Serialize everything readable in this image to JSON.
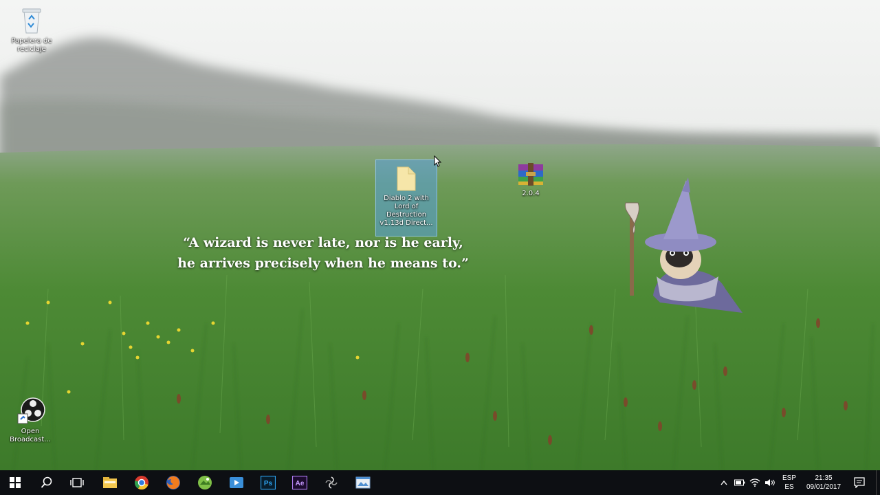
{
  "desktop": {
    "icons": [
      {
        "name": "recycle-bin",
        "label": "Papelera de reciclaje"
      },
      {
        "name": "selected-folder",
        "label": "Diablo 2 with Lord of Destruction v1.13d Direct..."
      },
      {
        "name": "winrar-archive",
        "label": "2.0.4"
      },
      {
        "name": "obs",
        "label": "Open Broadcast..."
      }
    ],
    "wallpaper_quote": {
      "line1": "“A wizard is never late, nor is he early,",
      "line2": "he arrives precisely when he means to.”"
    }
  },
  "taskbar": {
    "pinned": [
      "start-icon",
      "search-icon",
      "task-view-icon",
      "file-explorer-icon",
      "chrome-icon",
      "firefox-icon",
      "gallery-app-icon",
      "media-app-icon",
      "photoshop-icon",
      "after-effects-icon",
      "obs-taskbar-icon",
      "image-viewer-icon"
    ],
    "tray": {
      "lang_primary": "ESP",
      "lang_secondary": "ES",
      "time": "21:35",
      "date": "09/01/2017"
    }
  },
  "colors": {
    "taskbar_bg": "#0d0f13",
    "selection": "#5aa0dc"
  }
}
